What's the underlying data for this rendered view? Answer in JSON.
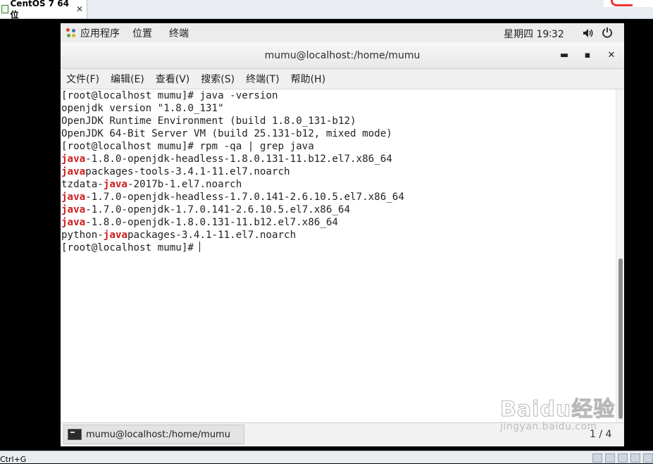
{
  "host": {
    "tab_title": "CentOS 7 64 位",
    "tab_close": "✕",
    "status_hint": "Ctrl+G"
  },
  "panel": {
    "applications": "应用程序",
    "places": "位置",
    "terminal": "终端",
    "clock": "星期四 19∶32"
  },
  "window": {
    "title": "mumu@localhost:/home/mumu",
    "minimize": "▬",
    "maximize": "▪",
    "close": "✕"
  },
  "menu": [
    "文件(F)",
    "编辑(E)",
    "查看(V)",
    "搜索(S)",
    "终端(T)",
    "帮助(H)"
  ],
  "terminal": {
    "lines": [
      [
        {
          "t": "[root@localhost mumu]# java -version"
        }
      ],
      [
        {
          "t": "openjdk version \"1.8.0_131\""
        }
      ],
      [
        {
          "t": "OpenJDK Runtime Environment (build 1.8.0_131-b12)"
        }
      ],
      [
        {
          "t": "OpenJDK 64-Bit Server VM (build 25.131-b12, mixed mode)"
        }
      ],
      [
        {
          "t": "[root@localhost mumu]# rpm -qa | grep java"
        }
      ],
      [
        {
          "t": "java",
          "hl": true
        },
        {
          "t": "-1.8.0-openjdk-headless-1.8.0.131-11.b12.el7.x86_64"
        }
      ],
      [
        {
          "t": "java",
          "hl": true
        },
        {
          "t": "packages-tools-3.4.1-11.el7.noarch"
        }
      ],
      [
        {
          "t": "tzdata-"
        },
        {
          "t": "java",
          "hl": true
        },
        {
          "t": "-2017b-1.el7.noarch"
        }
      ],
      [
        {
          "t": "java",
          "hl": true
        },
        {
          "t": "-1.7.0-openjdk-headless-1.7.0.141-2.6.10.5.el7.x86_64"
        }
      ],
      [
        {
          "t": "java",
          "hl": true
        },
        {
          "t": "-1.7.0-openjdk-1.7.0.141-2.6.10.5.el7.x86_64"
        }
      ],
      [
        {
          "t": "java",
          "hl": true
        },
        {
          "t": "-1.8.0-openjdk-1.8.0.131-11.b12.el7.x86_64"
        }
      ],
      [
        {
          "t": "python-"
        },
        {
          "t": "java",
          "hl": true
        },
        {
          "t": "packages-3.4.1-11.el7.noarch"
        }
      ],
      [
        {
          "t": "[root@localhost mumu]# "
        },
        {
          "cursor": true
        }
      ]
    ],
    "highlight_color": "#cc1f1f"
  },
  "taskbar": {
    "item_label": "mumu@localhost:/home/mumu",
    "page": "1 / 4"
  },
  "watermark": {
    "main": "Baidu经验",
    "sub": "jingyan.baidu.com"
  }
}
